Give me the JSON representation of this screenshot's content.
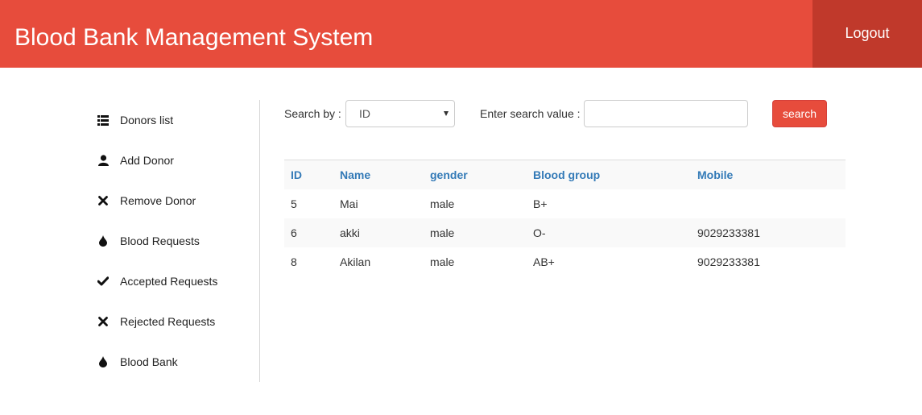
{
  "header": {
    "title": "Blood Bank Management System",
    "logout_label": "Logout",
    "bg_color": "#e74c3c",
    "logout_bg_color": "#c0392b"
  },
  "sidebar": {
    "items": [
      {
        "label": "Donors list",
        "icon": "list-icon"
      },
      {
        "label": "Add Donor",
        "icon": "user-icon"
      },
      {
        "label": "Remove Donor",
        "icon": "remove-icon"
      },
      {
        "label": "Blood Requests",
        "icon": "drop-icon"
      },
      {
        "label": "Accepted Requests",
        "icon": "check-icon"
      },
      {
        "label": "Rejected Requests",
        "icon": "remove-icon"
      },
      {
        "label": "Blood Bank",
        "icon": "drop-icon"
      }
    ]
  },
  "search": {
    "by_label": "Search by :",
    "selected_field": "ID",
    "value_label": "Enter search value :",
    "value": "",
    "button_label": "search"
  },
  "table": {
    "columns": [
      "ID",
      "Name",
      "gender",
      "Blood group",
      "Mobile"
    ],
    "rows": [
      [
        "5",
        "Mai",
        "male",
        "B+",
        ""
      ],
      [
        "6",
        "akki",
        "male",
        "O-",
        "9029233381"
      ],
      [
        "8",
        "Akilan",
        "male",
        "AB+",
        "9029233381"
      ]
    ]
  }
}
